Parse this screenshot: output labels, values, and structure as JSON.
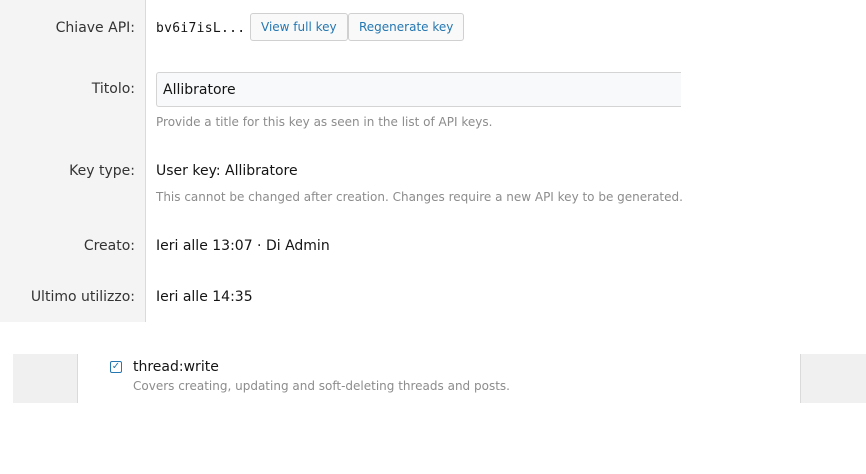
{
  "api_key": {
    "label": "Chiave API:",
    "value": "bv6i7isL...",
    "view_full_label": "View full key",
    "regenerate_label": "Regenerate key"
  },
  "title": {
    "label": "Titolo:",
    "value": "Allibratore",
    "hint": "Provide a title for this key as seen in the list of API keys."
  },
  "key_type": {
    "label": "Key type:",
    "value": "User key: Allibratore",
    "hint": "This cannot be changed after creation. Changes require a new API key to be generated."
  },
  "created": {
    "label": "Creato:",
    "value": "Ieri alle 13:07 · Di Admin"
  },
  "last_used": {
    "label": "Ultimo utilizzo:",
    "value": "Ieri alle 14:35"
  },
  "scope": {
    "checked": true,
    "check_glyph": "✓",
    "name": "thread:write",
    "description": "Covers creating, updating and soft-deleting threads and posts."
  },
  "colors": {
    "link_blue": "#2577b1",
    "label_panel": "#f4f4f4",
    "hint_gray": "#8c8c8c"
  }
}
